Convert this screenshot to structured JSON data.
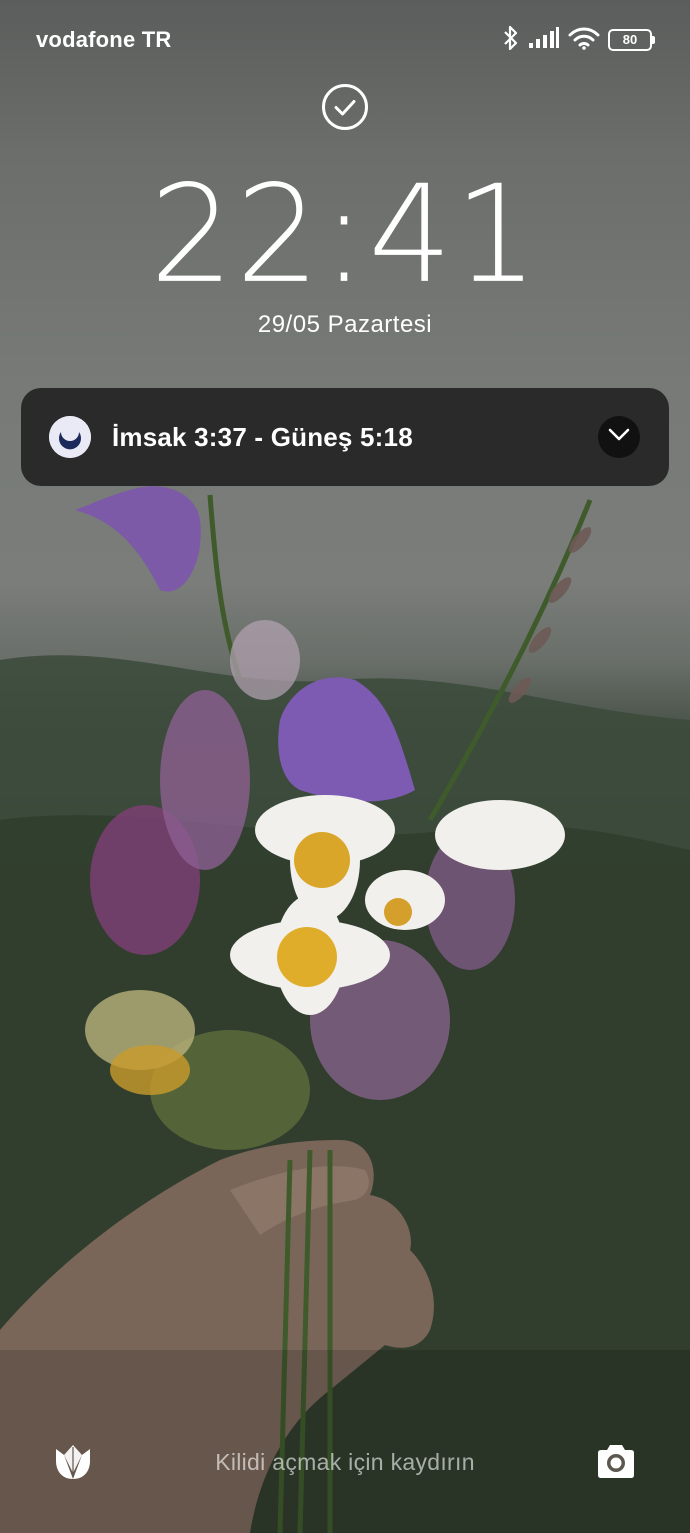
{
  "status_bar": {
    "carrier": "vodafone TR",
    "battery_level": "80",
    "icons": [
      "bluetooth-icon",
      "signal-icon",
      "wifi-icon",
      "battery-icon"
    ]
  },
  "lockscreen": {
    "time": "22:41",
    "date": "29/05 Pazartesi"
  },
  "notification": {
    "icon": "crescent-moon-icon",
    "text": "İmsak 3:37 - Güneş 5:18",
    "expand_icon": "chevron-down-icon"
  },
  "bottom": {
    "left_shortcut_icon": "tulip-icon",
    "unlock_hint": "Kilidi açmak için kaydırın",
    "right_shortcut_icon": "camera-icon"
  },
  "colors": {
    "notification_bg": "#262626",
    "moon_icon_bg": "#e9eaf6",
    "moon_color": "#1c2a5c"
  }
}
